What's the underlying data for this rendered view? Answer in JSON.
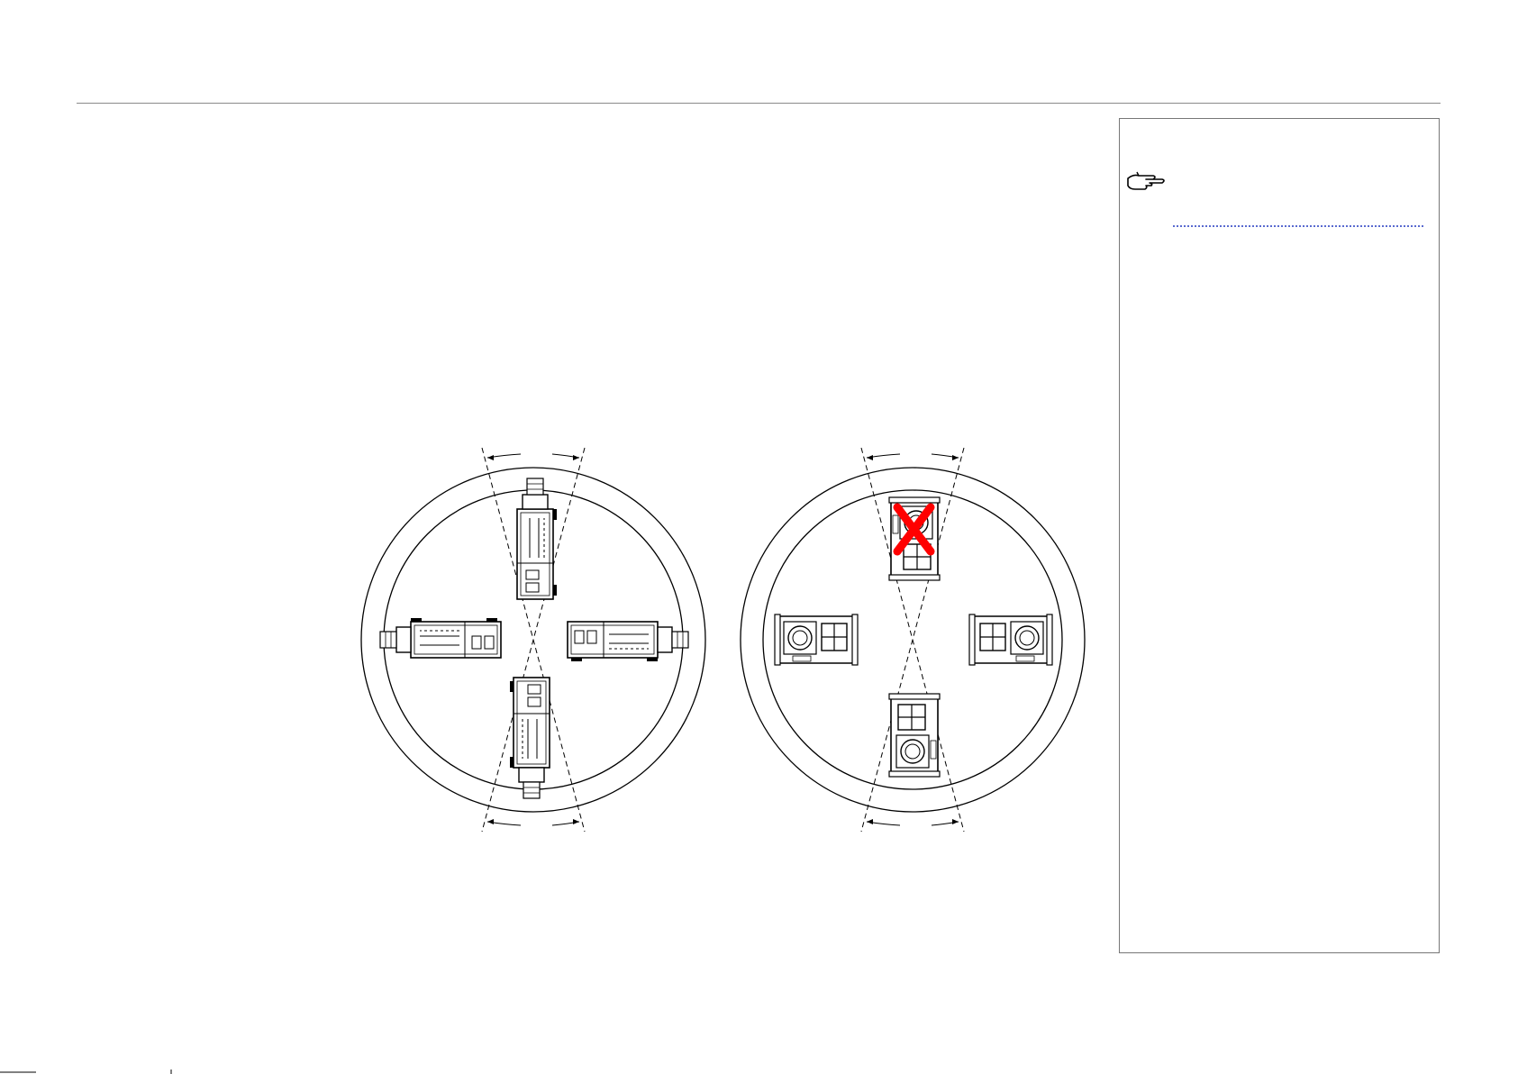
{
  "page": {
    "note_icon": "pointing-hand-icon",
    "colors": {
      "rule": "#8a8a8a",
      "note_line": "#5a6ad0",
      "cross": "#ff0000",
      "ink": "#000000"
    }
  },
  "diagrams": [
    {
      "name": "side-view-orientations",
      "units_shown": 4,
      "acceptable": true
    },
    {
      "name": "top-view-orientations",
      "units_shown": 4,
      "crossed_out": "top"
    }
  ]
}
